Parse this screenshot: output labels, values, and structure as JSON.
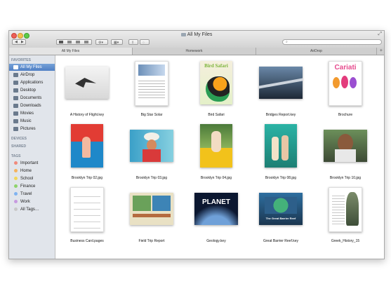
{
  "window": {
    "title": "All My Files"
  },
  "search": {
    "placeholder": ""
  },
  "toolbar": {
    "back": "◀",
    "forward": "▶",
    "action": "⚙▾",
    "arrange": "▦▾",
    "share": "⇪",
    "tags": "◌"
  },
  "tabs": [
    {
      "label": "All My Files",
      "active": true
    },
    {
      "label": "Homework",
      "active": false
    },
    {
      "label": "AirDrop",
      "active": false
    }
  ],
  "sidebar": {
    "favorites_header": "FAVORITES",
    "favorites": [
      {
        "label": "All My Files",
        "icon": "all-my-files-icon",
        "selected": true
      },
      {
        "label": "AirDrop",
        "icon": "airdrop-icon"
      },
      {
        "label": "Applications",
        "icon": "applications-icon"
      },
      {
        "label": "Desktop",
        "icon": "desktop-icon"
      },
      {
        "label": "Documents",
        "icon": "documents-icon"
      },
      {
        "label": "Downloads",
        "icon": "downloads-icon"
      },
      {
        "label": "Movies",
        "icon": "movies-icon"
      },
      {
        "label": "Music",
        "icon": "music-icon"
      },
      {
        "label": "Pictures",
        "icon": "pictures-icon"
      }
    ],
    "devices_header": "DEVICES",
    "shared_header": "SHARED",
    "tags_header": "TAGS",
    "tags": [
      {
        "label": "Important",
        "color": "#f08a7c"
      },
      {
        "label": "Home",
        "color": "#f4b35e"
      },
      {
        "label": "School",
        "color": "#f2d65a"
      },
      {
        "label": "Finance",
        "color": "#8ed36b"
      },
      {
        "label": "Travel",
        "color": "#7fb3f0"
      },
      {
        "label": "Work",
        "color": "#c79ae0"
      },
      {
        "label": "All Tags…",
        "color": "#c8c8c8"
      }
    ]
  },
  "files": [
    {
      "name": "A History of Flight.key",
      "thumb_title": ""
    },
    {
      "name": "Big Star Solar",
      "thumb_title": ""
    },
    {
      "name": "Bird Safari",
      "thumb_title": "Bird Safari"
    },
    {
      "name": "Bridges Report.key",
      "thumb_title": ""
    },
    {
      "name": "Brochure",
      "thumb_title": "Cariati"
    },
    {
      "name": "Brooklyn Trip 02.jpg",
      "thumb_title": ""
    },
    {
      "name": "Brooklyn Trip 03.jpg",
      "thumb_title": ""
    },
    {
      "name": "Brooklyn Trip 04.jpg",
      "thumb_title": ""
    },
    {
      "name": "Brooklyn Trip 08.jpg",
      "thumb_title": ""
    },
    {
      "name": "Brooklyn Trip 10.jpg",
      "thumb_title": ""
    },
    {
      "name": "Business Card.pages",
      "thumb_title": ""
    },
    {
      "name": "Field Trip Report",
      "thumb_title": ""
    },
    {
      "name": "Geology.key",
      "thumb_title": "PLANET"
    },
    {
      "name": "Great Barrier Reef.key",
      "thumb_title": "The Great Barrier Reef"
    },
    {
      "name": "Greek_History_15",
      "thumb_title": ""
    }
  ]
}
